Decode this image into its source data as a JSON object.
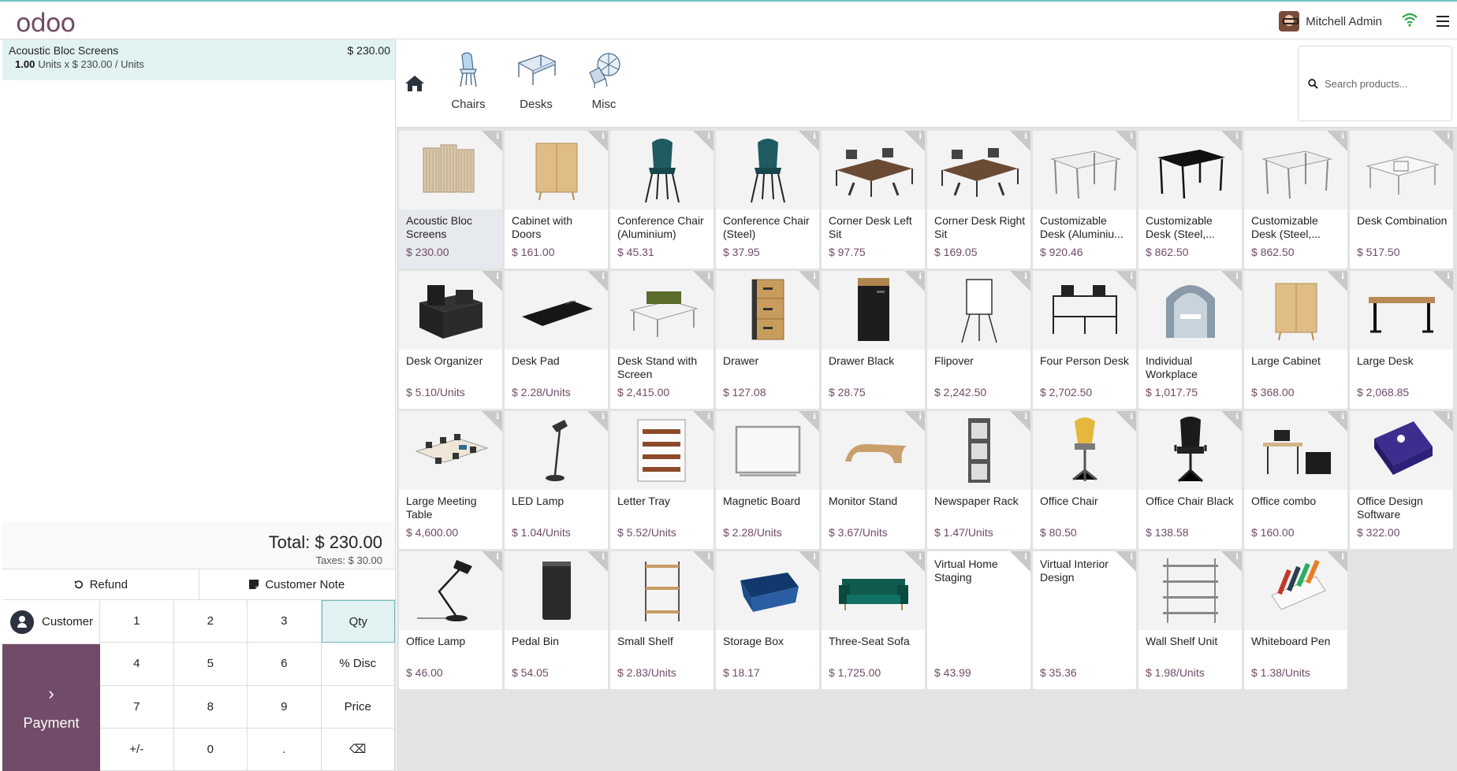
{
  "header": {
    "logo": "odoo",
    "user_name": "Mitchell Admin"
  },
  "order": {
    "line": {
      "name": "Acoustic Bloc Screens",
      "price": "$ 230.00",
      "qty": "1.00",
      "detail": "Units x $ 230.00 / Units"
    },
    "total": "Total: $ 230.00",
    "taxes": "Taxes: $ 30.00"
  },
  "actions": {
    "refund": "Refund",
    "customer_note": "Customer Note"
  },
  "pad": {
    "customer": "Customer",
    "payment": "Payment",
    "payment_icon": "chevron-right-icon",
    "keys": [
      "1",
      "2",
      "3",
      "Qty",
      "4",
      "5",
      "6",
      "% Disc",
      "7",
      "8",
      "9",
      "Price",
      "+/-",
      "0",
      ".",
      "⌫"
    ],
    "active_key": "Qty"
  },
  "categories": {
    "home_icon": "home-icon",
    "items": [
      {
        "label": "Chairs"
      },
      {
        "label": "Desks"
      },
      {
        "label": "Misc"
      }
    ]
  },
  "search": {
    "placeholder": "Search products..."
  },
  "colors": {
    "brand": "#714b67",
    "selected_line": "#e2f2f2",
    "accent_border": "#71c1c4"
  },
  "products": [
    {
      "name": "Acoustic Bloc Screens",
      "price": "$ 230.00",
      "shape": "screens"
    },
    {
      "name": "Cabinet with Doors",
      "price": "$ 161.00",
      "shape": "cabinet"
    },
    {
      "name": "Conference Chair (Aluminium)",
      "price": "$ 45.31",
      "shape": "chair-teal"
    },
    {
      "name": "Conference Chair (Steel)",
      "price": "$ 37.95",
      "shape": "chair-teal"
    },
    {
      "name": "Corner Desk Left Sit",
      "price": "$ 97.75",
      "shape": "desk-brown"
    },
    {
      "name": "Corner Desk Right Sit",
      "price": "$ 169.05",
      "shape": "desk-brown"
    },
    {
      "name": "Customizable Desk (Aluminiu...",
      "price": "$ 920.46",
      "shape": "desk-white"
    },
    {
      "name": "Customizable Desk (Steel,...",
      "price": "$ 862.50",
      "shape": "desk-black"
    },
    {
      "name": "Customizable Desk (Steel,...",
      "price": "$ 862.50",
      "shape": "desk-white"
    },
    {
      "name": "Desk Combination",
      "price": "$ 517.50",
      "shape": "desk-combo"
    },
    {
      "name": "Desk Organizer",
      "price": "$ 5.10/Units",
      "shape": "organizer"
    },
    {
      "name": "Desk Pad",
      "price": "$ 2.28/Units",
      "shape": "pad"
    },
    {
      "name": "Desk Stand with Screen",
      "price": "$ 2,415.00",
      "shape": "stand"
    },
    {
      "name": "Drawer",
      "price": "$ 127.08",
      "shape": "drawer"
    },
    {
      "name": "Drawer Black",
      "price": "$ 28.75",
      "shape": "drawer-black"
    },
    {
      "name": "Flipover",
      "price": "$ 2,242.50",
      "shape": "flipover"
    },
    {
      "name": "Four Person Desk",
      "price": "$ 2,702.50",
      "shape": "four-desk"
    },
    {
      "name": "Individual Workplace",
      "price": "$ 1,017.75",
      "shape": "pod"
    },
    {
      "name": "Large Cabinet",
      "price": "$ 368.00",
      "shape": "cabinet"
    },
    {
      "name": "Large Desk",
      "price": "$ 2,068.85",
      "shape": "large-desk"
    },
    {
      "name": "Large Meeting Table",
      "price": "$ 4,600.00",
      "shape": "meeting"
    },
    {
      "name": "LED Lamp",
      "price": "$ 1.04/Units",
      "shape": "lamp"
    },
    {
      "name": "Letter Tray",
      "price": "$ 5.52/Units",
      "shape": "tray"
    },
    {
      "name": "Magnetic Board",
      "price": "$ 2.28/Units",
      "shape": "board"
    },
    {
      "name": "Monitor Stand",
      "price": "$ 3.67/Units",
      "shape": "monitor-stand"
    },
    {
      "name": "Newspaper Rack",
      "price": "$ 1.47/Units",
      "shape": "rack"
    },
    {
      "name": "Office Chair",
      "price": "$ 80.50",
      "shape": "chair-yellow"
    },
    {
      "name": "Office Chair Black",
      "price": "$ 138.58",
      "shape": "chair-black"
    },
    {
      "name": "Office combo",
      "price": "$ 160.00",
      "shape": "combo"
    },
    {
      "name": "Office Design Software",
      "price": "$ 322.00",
      "shape": "software"
    },
    {
      "name": "Office Lamp",
      "price": "$ 46.00",
      "shape": "lamp-big"
    },
    {
      "name": "Pedal Bin",
      "price": "$ 54.05",
      "shape": "bin"
    },
    {
      "name": "Small Shelf",
      "price": "$ 2.83/Units",
      "shape": "shelf"
    },
    {
      "name": "Storage Box",
      "price": "$ 18.17",
      "shape": "box"
    },
    {
      "name": "Three-Seat Sofa",
      "price": "$ 1,725.00",
      "shape": "sofa"
    },
    {
      "name": "Virtual Home Staging",
      "price": "$ 43.99",
      "shape": "none"
    },
    {
      "name": "Virtual Interior Design",
      "price": "$ 35.36",
      "shape": "none"
    },
    {
      "name": "Wall Shelf Unit",
      "price": "$ 1.98/Units",
      "shape": "wall-shelf"
    },
    {
      "name": "Whiteboard Pen",
      "price": "$ 1.38/Units",
      "shape": "pens"
    }
  ]
}
